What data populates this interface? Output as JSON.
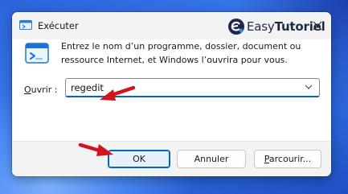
{
  "window": {
    "title": "Exécuter",
    "app_icon": "run-app-icon",
    "close_icon": "close-icon"
  },
  "watermark": {
    "brand_prefix": "Easy",
    "brand_suffix": "Tutoriel",
    "logo": "easytutoriel-logo"
  },
  "content": {
    "run_icon": "run-dialog-icon",
    "description": "Entrez le nom d’un programme, dossier, document ou ressource Internet, et Windows l’ouvrira pour vous.",
    "open_label_first": "O",
    "open_label_rest": "uvrir :",
    "open_value": "regedit",
    "dropdown_icon": "chevron-down-icon"
  },
  "buttons": {
    "ok": "OK",
    "cancel": "Annuler",
    "browse_first": "P",
    "browse_rest": "arcourir..."
  },
  "annotations": {
    "arrow_color": "#d4141c",
    "arrows": [
      "red-arrow-to-input",
      "red-arrow-to-ok"
    ]
  },
  "colors": {
    "accent": "#0067c0",
    "wallpaper": "#2c63da"
  }
}
